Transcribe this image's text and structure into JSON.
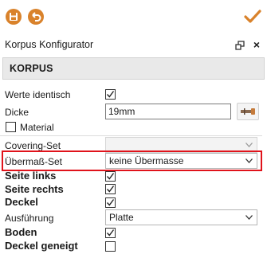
{
  "toolbar": {
    "save_icon": "save-icon",
    "undo_icon": "undo-icon",
    "confirm_icon": "checkmark-icon",
    "accent_color": "#d9822b"
  },
  "panel": {
    "title": "Korpus Konfigurator",
    "float_icon": "float-window-icon",
    "close_label": "×"
  },
  "section": {
    "label": "KORPUS"
  },
  "fields": {
    "werte_identisch": {
      "label": "Werte identisch",
      "checked": true
    },
    "dicke": {
      "label": "Dicke",
      "value": "19mm",
      "picker_icon": "pick-thickness-icon"
    },
    "material": {
      "label": "Material",
      "checked": false
    },
    "covering_set": {
      "label": "Covering-Set",
      "value": "",
      "disabled": true
    },
    "uebermass_set": {
      "label": "Übermaß-Set",
      "value": "keine Übermasse",
      "highlight_color": "#e0131b"
    },
    "seite_links": {
      "label": "Seite links",
      "checked": true
    },
    "seite_rechts": {
      "label": "Seite rechts",
      "checked": true
    },
    "deckel": {
      "label": "Deckel",
      "checked": true
    },
    "ausfuehrung": {
      "label": "Ausführung",
      "value": "Platte"
    },
    "boden": {
      "label": "Boden",
      "checked": true
    },
    "deckel_geneigt": {
      "label": "Deckel geneigt",
      "checked": false
    }
  }
}
